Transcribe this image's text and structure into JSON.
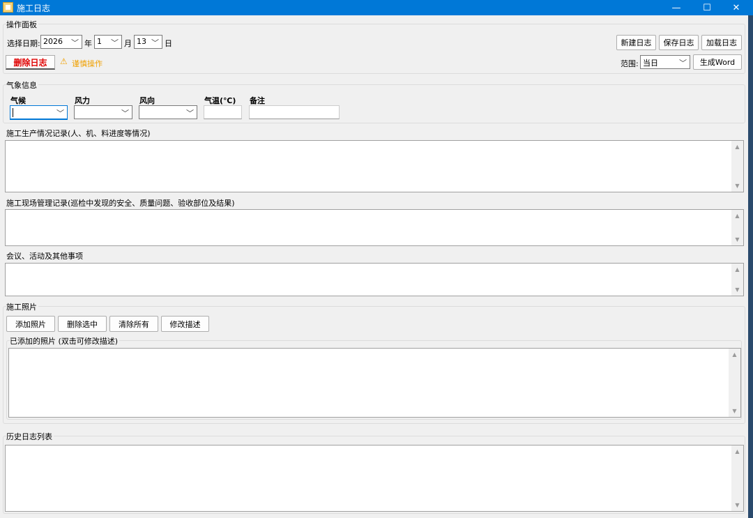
{
  "window": {
    "title": "施工日志",
    "controls": {
      "minimize": "—",
      "maximize": "☐",
      "close": "✕"
    }
  },
  "ops_panel": {
    "legend": "操作面板",
    "date_label": "选择日期:",
    "year": {
      "value": "2026",
      "unit": "年"
    },
    "month": {
      "value": "1",
      "unit": "月"
    },
    "day": {
      "value": "13",
      "unit": "日"
    },
    "delete_button": "删除日志",
    "warning_text": "谨慎操作",
    "new_button": "新建日志",
    "save_button": "保存日志",
    "load_button": "加载日志",
    "range_label": "范围:",
    "range_value": "当日",
    "word_button": "生成Word"
  },
  "weather": {
    "legend": "气象信息",
    "labels": {
      "weather": "气候",
      "wind_force": "风力",
      "wind_dir": "风向",
      "temp": "气温(℃)",
      "note": "备注"
    },
    "values": {
      "weather": "",
      "wind_force": "",
      "wind_dir": "",
      "temp": "",
      "note": ""
    }
  },
  "production": {
    "legend": "施工生产情况记录(人、机、料进度等情况)"
  },
  "management": {
    "legend": "施工现场管理记录(巡检中发现的安全、质量问题、验收部位及结果)"
  },
  "meetings": {
    "legend": "会议、活动及其他事项"
  },
  "photos": {
    "legend": "施工照片",
    "add_button": "添加照片",
    "delete_selected_button": "删除选中",
    "clear_all_button": "清除所有",
    "edit_desc_button": "修改描述",
    "list_legend": "已添加的照片 (双击可修改描述)"
  },
  "history": {
    "legend": "历史日志列表"
  },
  "icons": {
    "app": "app-icon",
    "warning": "warning-icon",
    "chevron": "chevron-down-icon"
  },
  "colors": {
    "titlebar": "#0078d7",
    "danger": "#e00000",
    "warning": "#f0a000"
  }
}
